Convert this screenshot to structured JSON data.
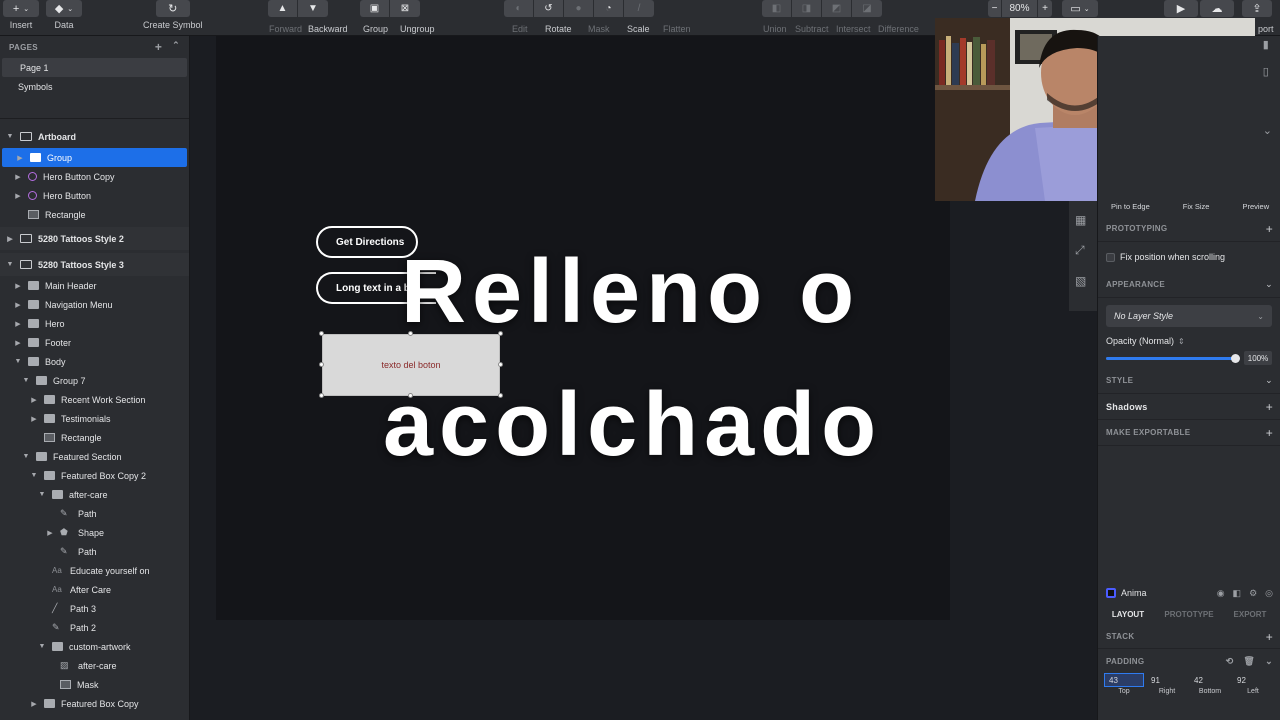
{
  "toolbar": {
    "insert": "Insert",
    "data": "Data",
    "create_symbol": "Create Symbol",
    "forward": "Forward",
    "backward": "Backward",
    "group": "Group",
    "ungroup": "Ungroup",
    "edit": "Edit",
    "rotate": "Rotate",
    "mask": "Mask",
    "scale": "Scale",
    "flatten": "Flatten",
    "union": "Union",
    "subtract": "Subtract",
    "intersect": "Intersect",
    "difference": "Difference",
    "zoom": "80%",
    "export_partial": "port"
  },
  "sidebar": {
    "pages_title": "PAGES",
    "pages": [
      "Page 1",
      "Symbols"
    ],
    "layers": [
      {
        "label": "Artboard",
        "icon": "artboard-icon"
      },
      {
        "label": "Group",
        "icon": "folder-icon"
      },
      {
        "label": "Hero Button Copy",
        "icon": "symbol-icon"
      },
      {
        "label": "Hero Button",
        "icon": "symbol-icon"
      },
      {
        "label": "Rectangle",
        "icon": "rectangle-icon"
      },
      {
        "label": "5280 Tattoos Style 2",
        "icon": "artboard-icon"
      },
      {
        "label": "5280 Tattoos Style 3",
        "icon": "artboard-icon"
      },
      {
        "label": "Main Header",
        "icon": "folder-icon"
      },
      {
        "label": "Navigation Menu",
        "icon": "folder-icon"
      },
      {
        "label": "Hero",
        "icon": "folder-icon"
      },
      {
        "label": "Footer",
        "icon": "folder-icon"
      },
      {
        "label": "Body",
        "icon": "folder-icon"
      },
      {
        "label": "Group 7",
        "icon": "folder-icon"
      },
      {
        "label": "Recent Work Section",
        "icon": "folder-icon"
      },
      {
        "label": "Testimonials",
        "icon": "folder-icon"
      },
      {
        "label": "Rectangle",
        "icon": "rectangle-icon"
      },
      {
        "label": "Featured Section",
        "icon": "folder-icon"
      },
      {
        "label": "Featured Box Copy 2",
        "icon": "folder-icon"
      },
      {
        "label": "after-care",
        "icon": "folder-icon"
      },
      {
        "label": "Path",
        "icon": "path-icon"
      },
      {
        "label": "Shape",
        "icon": "shape-icon"
      },
      {
        "label": "Path",
        "icon": "path-icon"
      },
      {
        "label": "Educate yourself on",
        "icon": "text-icon"
      },
      {
        "label": "After Care",
        "icon": "text-icon"
      },
      {
        "label": "Path 3",
        "icon": "line-icon"
      },
      {
        "label": "Path 2",
        "icon": "path-icon"
      },
      {
        "label": "custom-artwork",
        "icon": "folder-icon"
      },
      {
        "label": "after-care",
        "icon": "image-icon"
      },
      {
        "label": "Mask",
        "icon": "rectangle-icon"
      },
      {
        "label": "Featured Box Copy",
        "icon": "folder-icon"
      }
    ]
  },
  "canvas": {
    "button1": "Get Directions",
    "button2": "Long text in a bu",
    "rect_text": "texto del boton",
    "caption_line1": "Relleno o",
    "caption_line2": "acolchado"
  },
  "right_panel": {
    "pin_to_edge": "Pin to Edge",
    "fix_size": "Fix Size",
    "preview": "Preview",
    "prototyping": "PROTOTYPING",
    "fix_position": "Fix position when scrolling",
    "appearance": "APPEARANCE",
    "layer_style": "No Layer Style",
    "opacity_label": "Opacity (Normal)",
    "opacity_value": "100%",
    "opacity_fraction": 1.0,
    "style": "STYLE",
    "shadows": "Shadows",
    "make_exportable": "MAKE EXPORTABLE",
    "anima": "Anima",
    "tabs": [
      "LAYOUT",
      "PROTOTYPE",
      "EXPORT"
    ],
    "stack": "STACK",
    "padding": "PADDING",
    "padding_values": {
      "top": "43",
      "right": "91",
      "bottom": "42",
      "left": "92"
    },
    "padding_labels": {
      "top": "Top",
      "right": "Right",
      "bottom": "Bottom",
      "left": "Left"
    }
  },
  "colors": {
    "selection": "#1d6fe8",
    "symbol": "#b46de0",
    "panel": "#2b2d31",
    "canvas": "#1b1d22"
  }
}
